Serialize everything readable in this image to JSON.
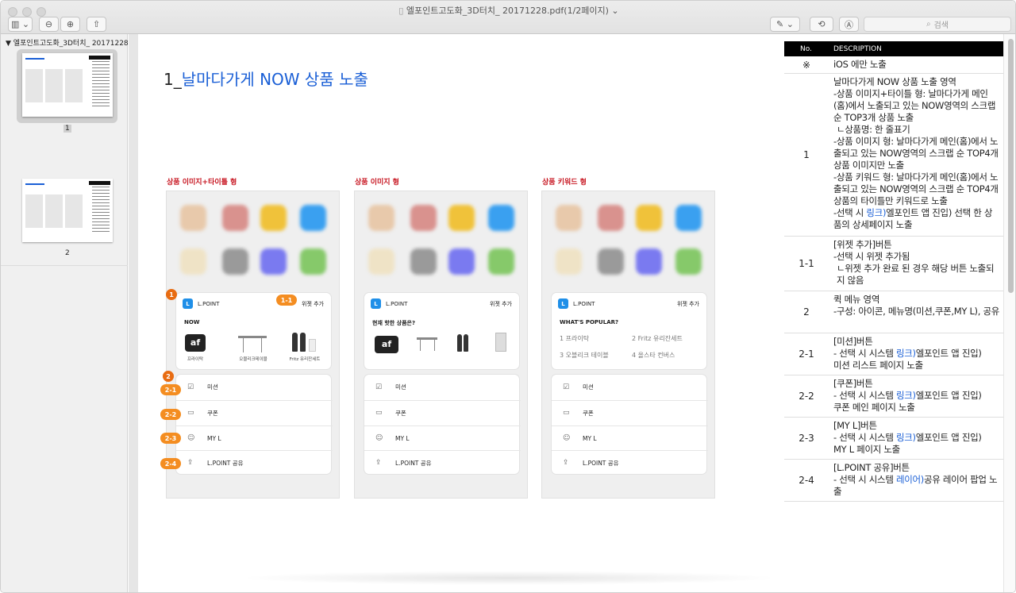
{
  "window": {
    "title": "엘포인트고도화_3D터치_ 20171228.pdf(1/2페이지)",
    "search_placeholder": "검색"
  },
  "sidebar": {
    "doc_name": "엘포인트고도화_3D터치_ 20171228...",
    "pages": [
      {
        "num": "1"
      },
      {
        "num": "2"
      }
    ]
  },
  "page": {
    "title_prefix": "1_",
    "title_highlight": "날마다가게 NOW 상품 노출"
  },
  "phones": [
    {
      "caption": "상품 이미지+타이틀 형",
      "brand": "L.POINT",
      "widget": "위젯 추가",
      "section": "NOW",
      "products": [
        "프라이탁",
        "오블리크테이블",
        "Fritz 유리잔세트"
      ]
    },
    {
      "caption": "상품 이미지 형",
      "brand": "L.POINT",
      "widget": "위젯 추가",
      "section": "현재 핫한 상품은?"
    },
    {
      "caption": "상품 키워드 형",
      "brand": "L.POINT",
      "widget": "위젯 추가",
      "section": "WHAT'S POPULAR?",
      "keywords": [
        "1 프라이탁",
        "2 Fritz 유리잔세트",
        "3 오블리크 테이블",
        "4 올스타 컨버스"
      ]
    }
  ],
  "menu": [
    "미션",
    "쿠폰",
    "MY L",
    "L.POINT 공유"
  ],
  "badges": {
    "b1": "1",
    "b11": "1-1",
    "b2": "2",
    "b21": "2-1",
    "b22": "2-2",
    "b23": "2-3",
    "b24": "2-4"
  },
  "desc_table": {
    "headers": [
      "No.",
      "DESCRIPTION"
    ],
    "rows": [
      {
        "no": "※",
        "lines": [
          "iOS 에만 노출"
        ]
      },
      {
        "no": "1",
        "lines": [
          "날마다가게 NOW 상품 노출 영역",
          "-상품 이미지+타이틀 형: 날마다가게 메인(홈)에서 노출되고 있는 NOW영역의 스크랩 순 TOP3개 상품 노출",
          "ㄴ상품명: 한 줄표기",
          "-상품 이미지 형: 날마다가게 메인(홈)에서 노출되고 있는 NOW영역의 스크랩 순 TOP4개 상품 이미지만 노출",
          "-상품 키워드 형: 날마다가게 메인(홈)에서 노출되고 있는 NOW영역의 스크랩 순 TOP4개 상품의 타이틀만 키워드로 노출",
          "-선택 시 링크)엘포인트 앱 진입) 선택 한 상품의 상세페이지 노출"
        ]
      },
      {
        "no": "1-1",
        "lines": [
          "[위젯 추가]버튼",
          "-선택 시 위젯 추가됨",
          "ㄴ위젯 추가 완료 된 경우 해당 버튼 노출되지 않음"
        ]
      },
      {
        "no": "2",
        "lines": [
          "퀵 메뉴 영역",
          "-구성: 아이콘, 메뉴명(미션,쿠폰,MY L), 공유"
        ]
      },
      {
        "no": "2-1",
        "lines": [
          "[미션]버튼",
          "- 선택 시 시스템 링크)엘포인트 앱 진입)",
          "미션 리스트 페이지 노출"
        ]
      },
      {
        "no": "2-2",
        "lines": [
          "[쿠폰]버튼",
          "- 선택 시 시스템 링크)엘포인트 앱 진입)",
          "쿠폰 메인 페이지 노출"
        ]
      },
      {
        "no": "2-3",
        "lines": [
          "[MY L]버튼",
          "- 선택 시 시스템 링크)엘포인트 앱 진입)",
          "MY L 페이지 노출"
        ]
      },
      {
        "no": "2-4",
        "lines": [
          "[L.POINT 공유]버튼",
          "- 선택 시 시스템 레이어)공유 레이어 팝업 노출"
        ]
      }
    ]
  }
}
